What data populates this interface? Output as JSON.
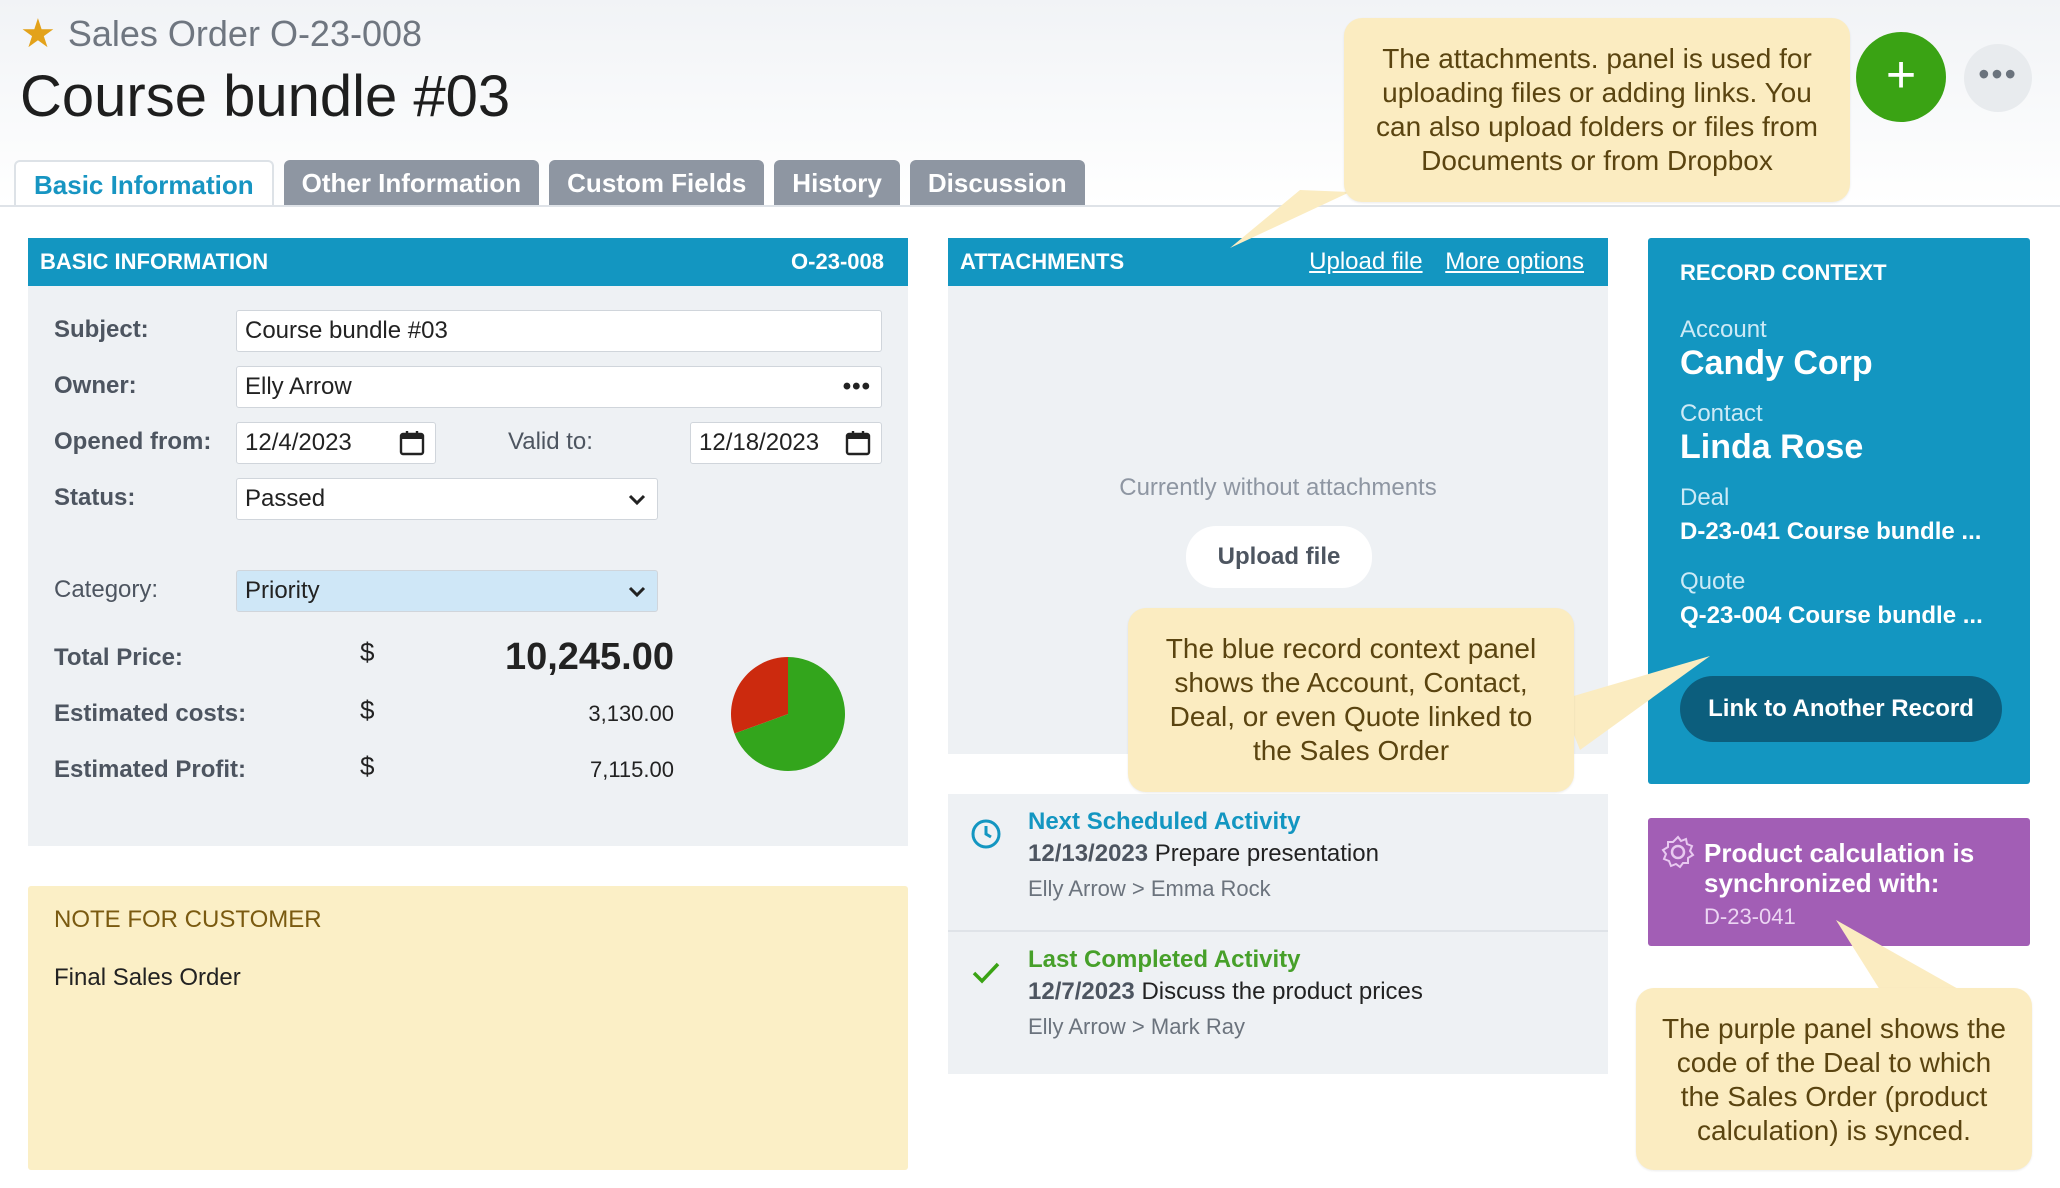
{
  "header": {
    "breadcrumb": "Sales Order O-23-008",
    "title": "Course bundle #03"
  },
  "tabs": [
    {
      "label": "Basic Information",
      "active": true
    },
    {
      "label": "Other Information"
    },
    {
      "label": "Custom Fields"
    },
    {
      "label": "History"
    },
    {
      "label": "Discussion"
    }
  ],
  "basic": {
    "header": "BASIC INFORMATION",
    "code": "O-23-008",
    "subject_label": "Subject:",
    "subject_value": "Course bundle #03",
    "owner_label": "Owner:",
    "owner_value": "Elly Arrow",
    "opened_label": "Opened from:",
    "opened_value": "12/4/2023",
    "valid_label": "Valid to:",
    "valid_value": "12/18/2023",
    "status_label": "Status:",
    "status_value": "Passed",
    "category_label": "Category:",
    "category_value": "Priority",
    "total_label": "Total Price:",
    "total_value": "10,245.00",
    "costs_label": "Estimated costs:",
    "costs_value": "3,130.00",
    "profit_label": "Estimated Profit:",
    "profit_value": "7,115.00",
    "currency": "$",
    "pie": {
      "costs": 3130,
      "profit": 7115,
      "costs_color": "#cc2a0e",
      "profit_color": "#33a51c"
    }
  },
  "note": {
    "header": "NOTE FOR CUSTOMER",
    "body": "Final Sales Order"
  },
  "attachments": {
    "header": "ATTACHMENTS",
    "upload_link": "Upload file",
    "more_link": "More options",
    "empty_text": "Currently without attachments",
    "upload_button": "Upload file"
  },
  "activities": {
    "next": {
      "title": "Next Scheduled Activity",
      "date": "12/13/2023",
      "text": "Prepare presentation",
      "people": "Elly Arrow > Emma Rock"
    },
    "last": {
      "title": "Last Completed Activity",
      "date": "12/7/2023",
      "text": "Discuss the product prices",
      "people": "Elly Arrow > Mark Ray"
    }
  },
  "context": {
    "header": "RECORD CONTEXT",
    "account_label": "Account",
    "account_value": "Candy Corp",
    "contact_label": "Contact",
    "contact_value": "Linda Rose",
    "deal_label": "Deal",
    "deal_value": "D-23-041 Course bundle ...",
    "quote_label": "Quote",
    "quote_value": "Q-23-004 Course bundle ...",
    "link_button": "Link to Another Record"
  },
  "sync": {
    "title_line1": "Product calculation is",
    "title_line2": "synchronized with:",
    "code": "D-23-041"
  },
  "callouts": {
    "attachments": "The attachments. panel is used for uploading files or adding links. You can also upload folders or files from Documents or from Dropbox",
    "context": "The blue record context panel shows the Account, Contact, Deal, or even Quote linked to the Sales Order",
    "purple": "The purple panel shows the code of the Deal to which the Sales Order (product calculation) is synced."
  },
  "colors": {
    "accent": "#1396c1",
    "add_button": "#3aa314",
    "purple_panel": "#a25eb5",
    "callout_bg": "#fbecc1"
  }
}
